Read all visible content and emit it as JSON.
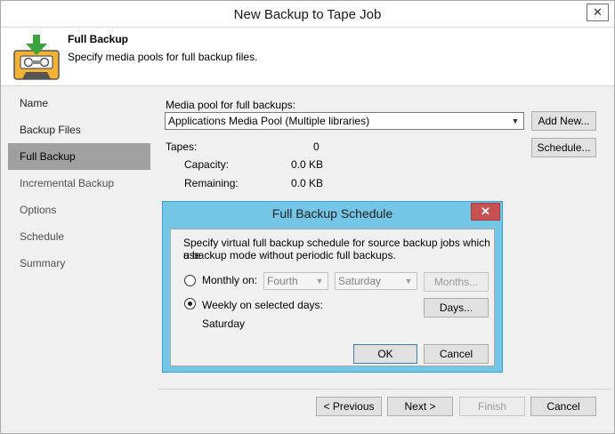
{
  "window": {
    "title": "New Backup to Tape Job",
    "close_glyph": "✕"
  },
  "header": {
    "title": "Full Backup",
    "subtitle": "Specify media pools for full backup files.",
    "icon": "tape-download-icon"
  },
  "nav": {
    "items": [
      {
        "label": "Name",
        "state": "normal"
      },
      {
        "label": "Backup Files",
        "state": "normal"
      },
      {
        "label": "Full Backup",
        "state": "active"
      },
      {
        "label": "Incremental Backup",
        "state": "dim"
      },
      {
        "label": "Options",
        "state": "dim"
      },
      {
        "label": "Schedule",
        "state": "dim"
      },
      {
        "label": "Summary",
        "state": "dim"
      }
    ]
  },
  "main": {
    "media_pool_label": "Media pool for full backups:",
    "media_pool_value": "Applications Media Pool (Multiple libraries)",
    "add_new_label": "Add New...",
    "schedule_label": "Schedule...",
    "tapes_label": "Tapes:",
    "tapes_value": "0",
    "capacity_label": "Capacity:",
    "capacity_value": "0.0 KB",
    "remaining_label": "Remaining:",
    "remaining_value": "0.0 KB"
  },
  "dialog": {
    "title": "Full Backup Schedule",
    "close_glyph": "✕",
    "description_line1": "Specify virtual full backup schedule for source backup jobs which use",
    "description_line2": "a backup mode without periodic full backups.",
    "monthly_label": "Monthly on:",
    "monthly_checked": false,
    "week_value": "Fourth",
    "day_value": "Saturday",
    "months_label": "Months...",
    "weekly_label": "Weekly on selected days:",
    "weekly_checked": true,
    "weekly_days": "Saturday",
    "days_label": "Days...",
    "ok_label": "OK",
    "cancel_label": "Cancel"
  },
  "footer": {
    "previous_label": "< Previous",
    "next_label": "Next >",
    "finish_label": "Finish",
    "cancel_label": "Cancel"
  },
  "colors": {
    "dialog_frame": "#74c6e6",
    "dialog_close": "#c75050",
    "nav_active": "#a0a0a0",
    "icon_green": "#3aa43a",
    "icon_orange": "#f3b234"
  }
}
